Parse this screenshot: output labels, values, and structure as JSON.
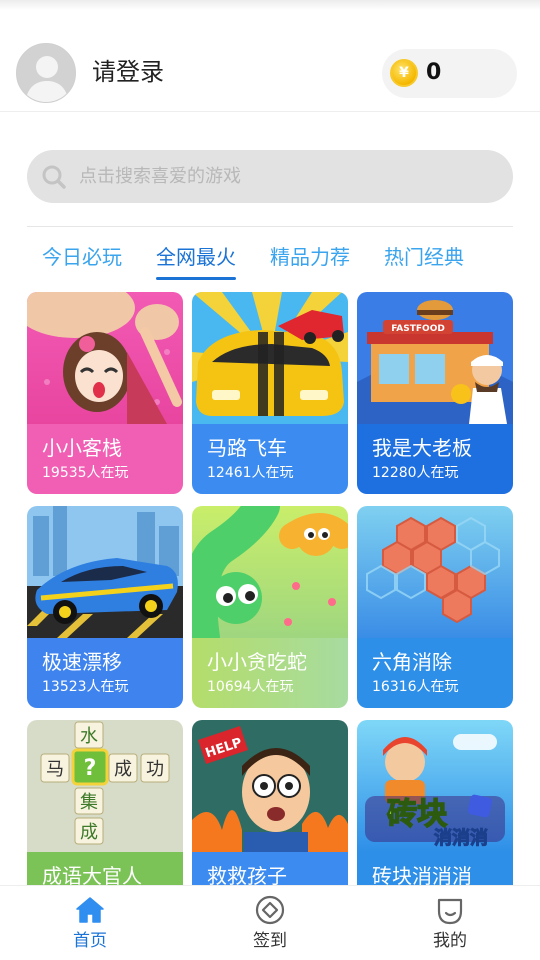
{
  "header": {
    "login_text": "请登录",
    "coin_count": "0",
    "coin_symbol": "¥"
  },
  "search": {
    "placeholder": "点击搜索喜爱的游戏",
    "value": ""
  },
  "tabs": [
    {
      "label": "今日必玩",
      "active": false
    },
    {
      "label": "全网最火",
      "active": true
    },
    {
      "label": "精品力荐",
      "active": false
    },
    {
      "label": "热门经典",
      "active": false
    }
  ],
  "games": [
    {
      "title": "小小客栈",
      "players": "19535人在玩",
      "color": "#f05fb4"
    },
    {
      "title": "马路飞车",
      "players": "12461人在玩",
      "color": "#3b8bf0"
    },
    {
      "title": "我是大老板",
      "players": "12280人在玩",
      "color": "#1e6fe0"
    },
    {
      "title": "极速漂移",
      "players": "13523人在玩",
      "color": "#3f84ee"
    },
    {
      "title": "小小贪吃蛇",
      "players": "10694人在玩",
      "color": "#9dd27a"
    },
    {
      "title": "六角消除",
      "players": "16316人在玩",
      "color": "#2e8fe8"
    },
    {
      "title": "成语大官人",
      "players": "",
      "color": "#7bc257"
    },
    {
      "title": "救救孩子",
      "players": "",
      "color": "#3b8bf0"
    },
    {
      "title": "砖块消消消",
      "players": "",
      "color": "#2e8fe8"
    }
  ],
  "art_text": {
    "idiom_chars": [
      "水",
      "马",
      "?",
      "成",
      "功",
      "集",
      "成"
    ],
    "help_sign": "HELP",
    "fastfood_sign": "FASTFOOD",
    "brick_logo_top": "砖块",
    "brick_logo_bottom": "消消消"
  },
  "bottom_nav": [
    {
      "label": "首页",
      "icon": "home-icon",
      "active": true
    },
    {
      "label": "签到",
      "icon": "checkin-icon",
      "active": false
    },
    {
      "label": "我的",
      "icon": "profile-icon",
      "active": false
    }
  ],
  "colors": {
    "accent": "#1b73d6",
    "tab_inactive": "#3aa4ee",
    "search_bg": "#e2e2e2",
    "coin": "#f5b800"
  }
}
